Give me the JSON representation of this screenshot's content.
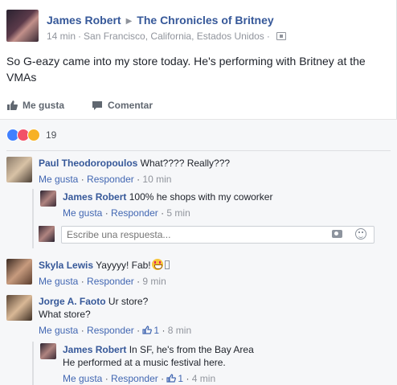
{
  "post": {
    "author": "James Robert",
    "group": "The Chronicles of Britney",
    "time": "14 min",
    "location": "San Francisco, California, Estados Unidos",
    "separator": "·",
    "text": "So G-eazy came into my store today. He's performing with Britney at the VMAs"
  },
  "actions": {
    "like_label": "Me gusta",
    "comment_label": "Comentar"
  },
  "reactions": {
    "count": "19",
    "types": [
      "like-icon",
      "love-icon",
      "wow-icon"
    ],
    "colors": {
      "like": "#4080ff",
      "love": "#f25268",
      "wow": "#f7b125"
    }
  },
  "comments": [
    {
      "author": "Paul Theodoropoulos",
      "text": "What???? Really???",
      "like": "Me gusta",
      "reply": "Responder",
      "time": "10 min",
      "replies": [
        {
          "author": "James Robert",
          "text": "100% he shops with my coworker",
          "like": "Me gusta",
          "reply": "Responder",
          "time": "5 min"
        }
      ]
    },
    {
      "author": "Skyla Lewis",
      "text": "Yayyyy! Fab!",
      "like": "Me gusta",
      "reply": "Responder",
      "time": "9 min"
    },
    {
      "author": "Jorge A. Faoto",
      "text_line1": "Ur store?",
      "text_line2": "What store?",
      "like": "Me gusta",
      "reply": "Responder",
      "like_count": "1",
      "time": "8 min",
      "replies": [
        {
          "author": "James Robert",
          "text_line1": "In SF, he's from the Bay Area",
          "text_line2": "He performed at a music festival here.",
          "like": "Me gusta",
          "reply": "Responder",
          "like_count": "1",
          "time": "4 min"
        }
      ]
    }
  ],
  "reply_input": {
    "placeholder": "Escribe una respuesta..."
  }
}
